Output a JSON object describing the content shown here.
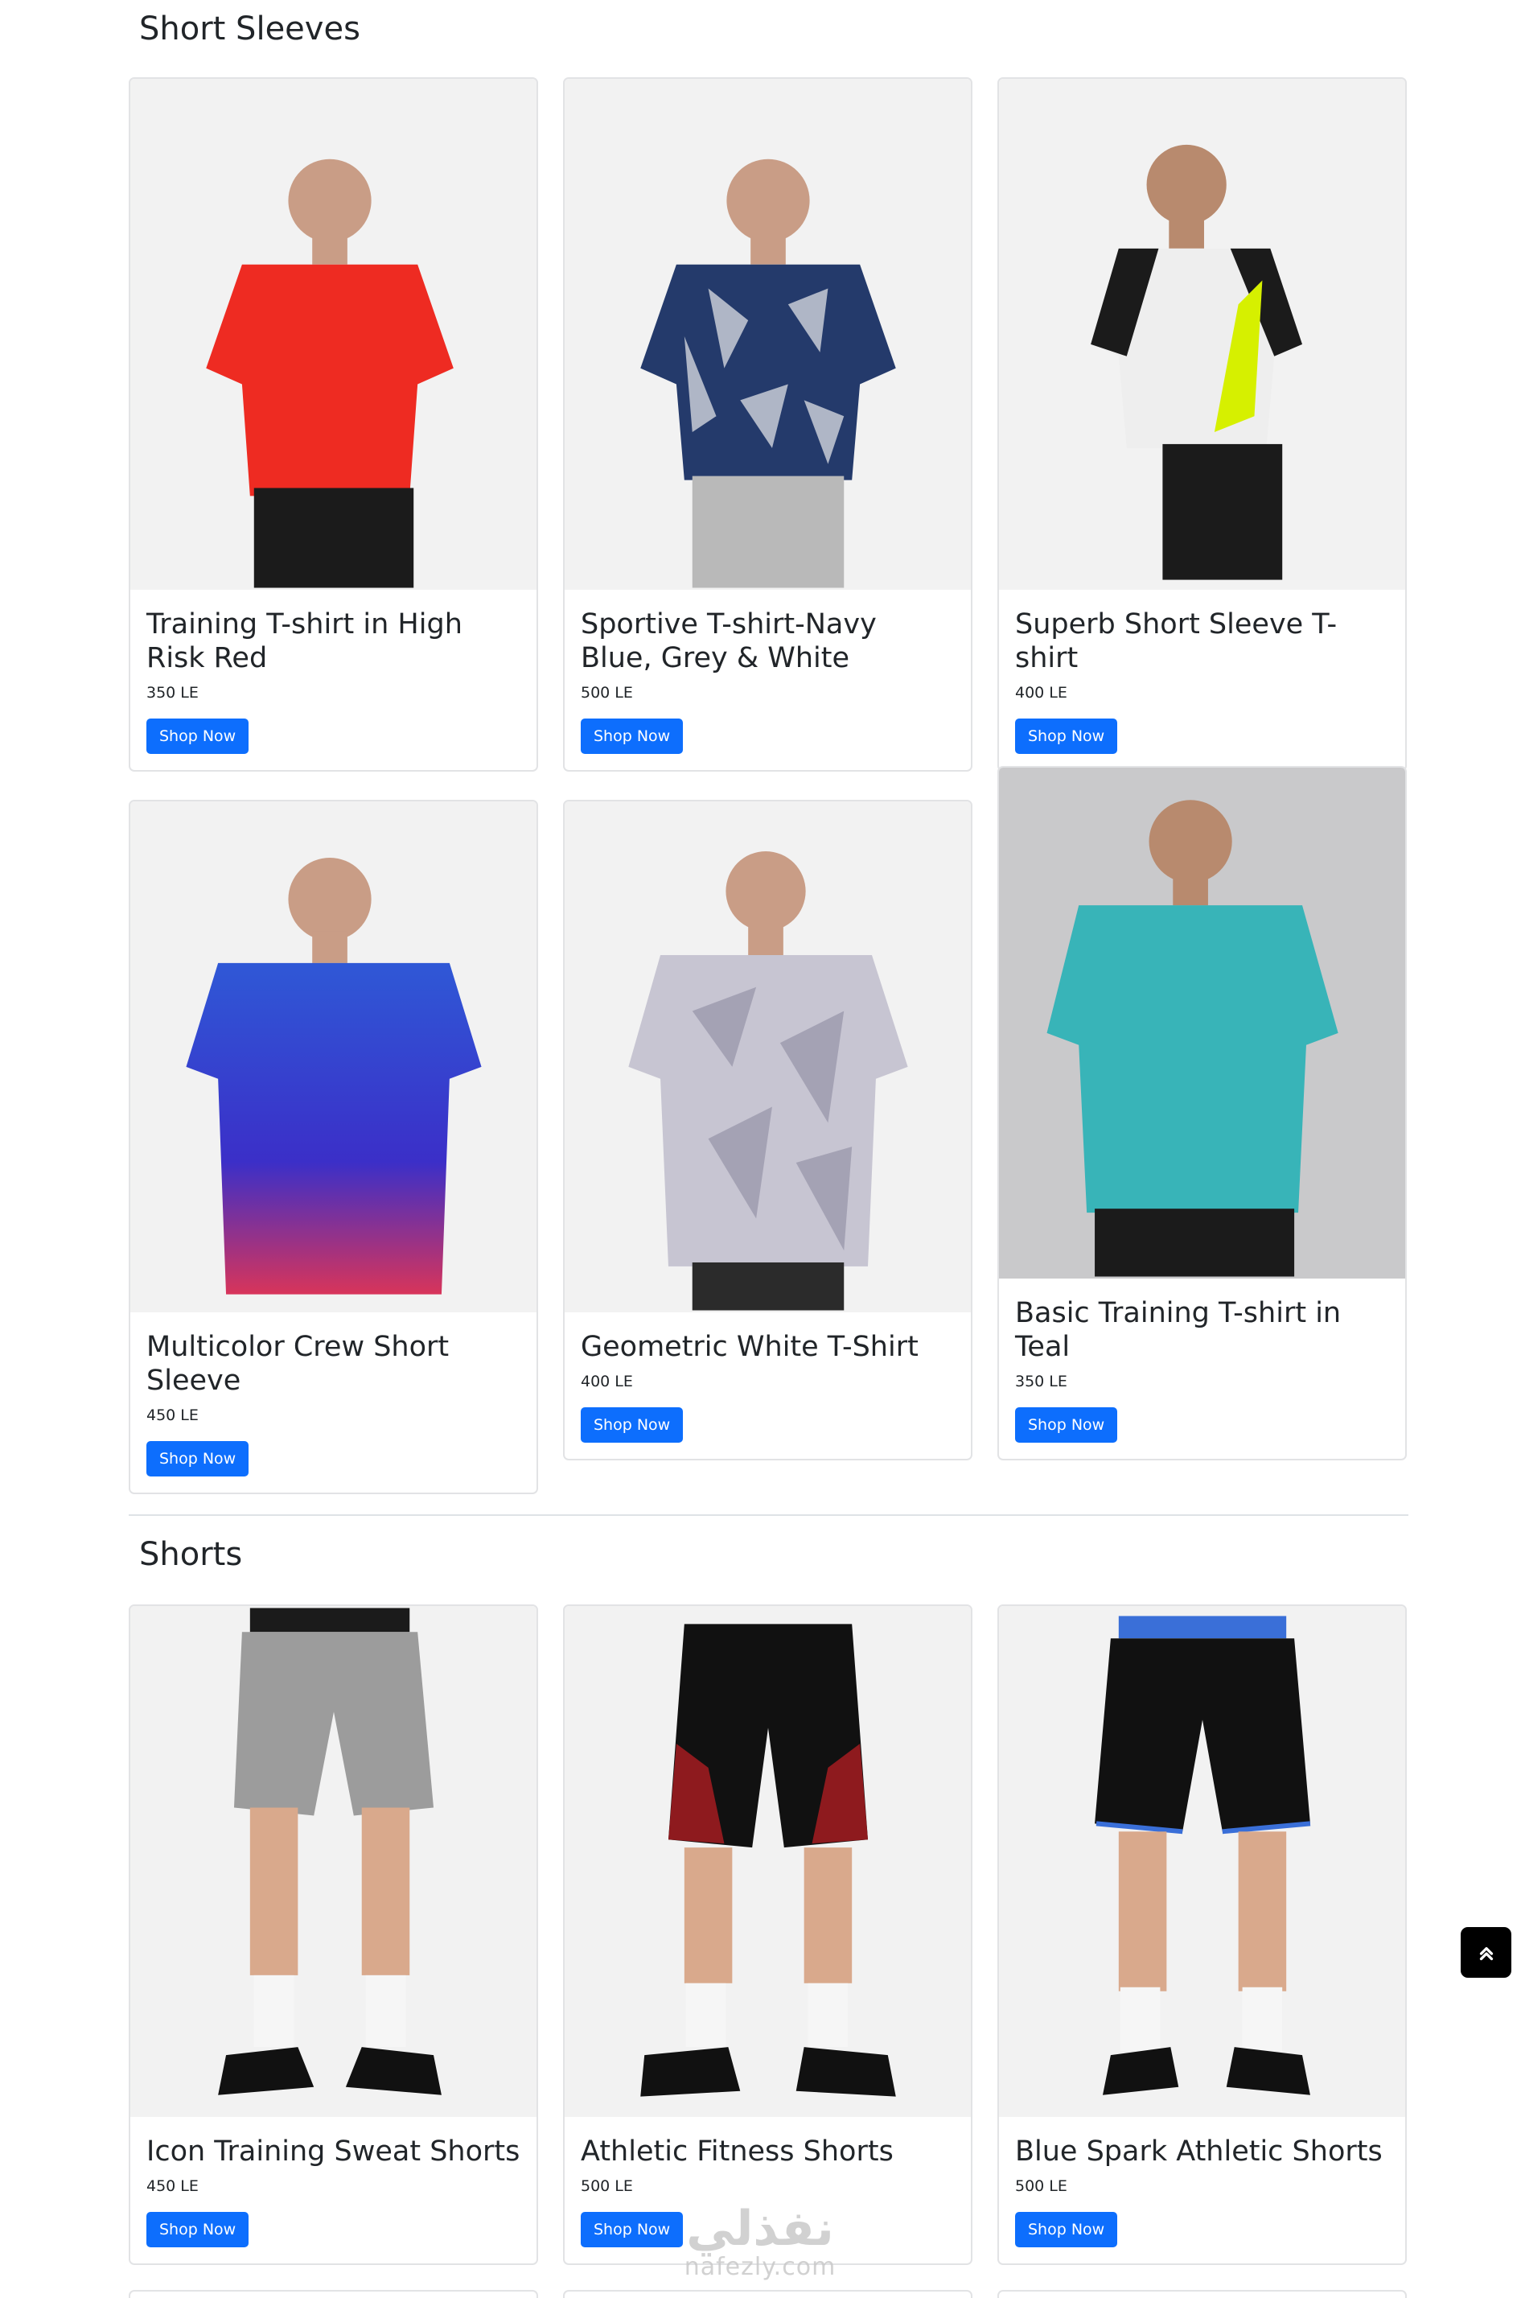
{
  "sections": [
    {
      "title": "Short Sleeves",
      "products": [
        {
          "name": "Training T-shirt in High Risk Red",
          "price": "350 LE",
          "button": "Shop Now",
          "shirt_color": "#ee2b22",
          "bottom_color": "#1b1b1b"
        },
        {
          "name": "Sportive T-shirt-Navy Blue, Grey & White",
          "price": "500 LE",
          "button": "Shop Now",
          "shirt_color": "#243a6b",
          "bottom_color": "#b9b9b9"
        },
        {
          "name": "Superb Short Sleeve T-shirt",
          "price": "400 LE",
          "button": "Shop Now",
          "shirt_color": "#eeeeee",
          "bottom_color": "#1b1b1b"
        },
        {
          "name": "Multicolor Crew Short Sleeve",
          "price": "450 LE",
          "button": "Shop Now",
          "shirt_color": "#2f58d6",
          "bottom_color": "#1b1b1b"
        },
        {
          "name": "Geometric White T-Shirt",
          "price": "400 LE",
          "button": "Shop Now",
          "shirt_color": "#c7c5d2",
          "bottom_color": "#2b2b2b"
        },
        {
          "name": "Basic Training T-shirt in Teal",
          "price": "350 LE",
          "button": "Shop Now",
          "shirt_color": "#38b4b8",
          "bottom_color": "#1b1b1b"
        }
      ]
    },
    {
      "title": "Shorts",
      "products": [
        {
          "name": "Icon Training Sweat Shorts",
          "price": "450 LE",
          "button": "Shop Now",
          "shorts_color": "#9c9c9c"
        },
        {
          "name": "Athletic Fitness Shorts",
          "price": "500 LE",
          "button": "Shop Now",
          "shorts_color": "#111111"
        },
        {
          "name": "Blue Spark Athletic Shorts",
          "price": "500 LE",
          "button": "Shop Now",
          "shorts_color": "#111111"
        }
      ]
    }
  ],
  "watermark": {
    "arabic": "نفذلي",
    "latin": "nafezly.com"
  },
  "scroll_top_icon": "double-chevron-up-icon"
}
